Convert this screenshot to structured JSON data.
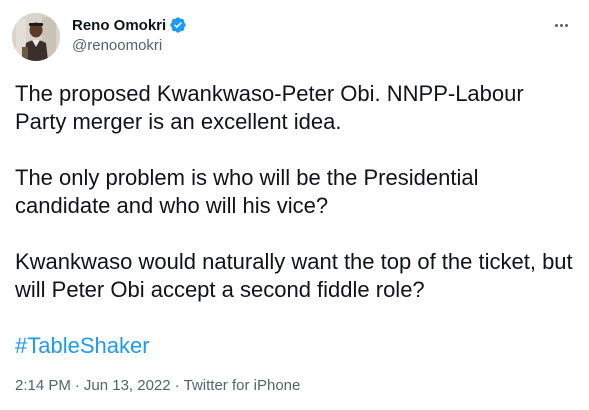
{
  "author": {
    "display_name": "Reno Omokri",
    "handle": "@renoomokri",
    "verified": true,
    "avatar": "profile-photo"
  },
  "tweet": {
    "paragraphs": [
      "The proposed Kwankwaso-Peter Obi. NNPP-Labour Party merger is an excellent idea.",
      "The only problem is who will be the Presidential candidate and who will his vice?",
      "Kwankwaso would naturally want the top of the ticket, but will Peter Obi accept a second fiddle role?"
    ],
    "hashtag": "#TableShaker"
  },
  "meta": {
    "time": "2:14 PM",
    "separator": "·",
    "date": "Jun 13, 2022",
    "source": "Twitter for iPhone"
  },
  "icons": {
    "verified": "verified-badge-icon",
    "more": "more-options-icon"
  },
  "colors": {
    "text": "#0f1419",
    "secondary": "#536471",
    "accent": "#1d9bf0"
  }
}
